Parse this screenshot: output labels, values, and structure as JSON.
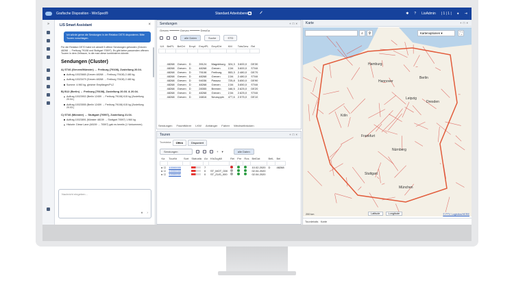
{
  "window": {
    "app_title": "Grafische Disposition - WinSped®",
    "workspace": "Standard Arbeitsbereich",
    "user": "LisAdmin",
    "counter": "| 1 | 1 |"
  },
  "assistant": {
    "title": "LIS Smart Assistant",
    "user_msg": "Ich würde gerne die Sendungen in der Relation DE70 disponieren. Bitte Touren vorschlagen.",
    "intro": "Für die Relation DE70 habe ich aktuell 5 offene Sendungen gefunden (Greven 48268 → Freiburg 79108 und Stuttgart 70597). Es gibt keine passenden offenen Touren in dem Zeitraum, in die man diese kombinieren könnte.",
    "heading": "Sendungen (Cluster)",
    "clusters": [
      {
        "title": "A) ST46 (Greven/Münster) → Freiburg (79108), Zustellung 20.04.",
        "items": [
          "Auftrag 10023665 (Greven 48268 → Freiburg 79108) 2.480 kg",
          "Auftrag 10023479 (Greven 48268 → Freiburg 79108) 2.480 kg",
          "Summe: 4.960 kg, gleicher Empfänger/PLZ"
        ]
      },
      {
        "title": "B) B12 (Berlin) → Freiburg (79108), Zustellung 20.03. & 20.04.",
        "items": [
          "Auftrag 10023902 (Berlin 12459 → Freiburg 79108) 615 kg (Zustellung 20.04.)",
          "Auftrag 10023555 (Berlin 12459 → Freiburg 79108) 615 kg (Zustellung 20.03.)"
        ]
      },
      {
        "title": "C) ST46 (Münster) → Stuttgart (70597), Zustellung 21.04.",
        "items": [
          "Auftrag 10023891 (Münster 48159 → Stuttgart 70597) 1.960 kg",
          "Historie: Diese Lane (48159 → 70597) gab es bereits (1 Vorkommen)."
        ]
      }
    ],
    "message_placeholder": "Nachricht eingeben..."
  },
  "sendungen": {
    "title": "Sendungen",
    "filter_text": "Greven ━━━━━━ Greven ━━━━━━ Dreußa",
    "all_data_btn": "alle Daten",
    "search_label": "Suche",
    "std_label": "STD",
    "columns": [
      "ILK",
      "BelPL",
      "BelOrt",
      "Empf.",
      "EmpfPL",
      "EmpfOrt",
      "KM",
      "TotsGew",
      "Rel"
    ],
    "rows": [
      [
        "",
        "48268",
        "Greven",
        "D",
        "39124",
        "Magdeburg",
        "324,3",
        "3.600,0",
        "DE30"
      ],
      [
        "",
        "48268",
        "Greven",
        "D",
        "48268",
        "Greven",
        "2,54",
        "3.600,0",
        "ST48"
      ],
      [
        "",
        "48268",
        "Greven",
        "D",
        "79108",
        "Freiburg",
        "553,3",
        "2.480,0",
        "DE70"
      ],
      [
        "",
        "48268",
        "Greven",
        "D",
        "48268",
        "Greven",
        "2,54",
        "2.480,0",
        "ST48"
      ],
      [
        "",
        "48268",
        "Greven",
        "D",
        "94036",
        "Passau",
        "725,8",
        "3.650,0",
        "DE90"
      ],
      [
        "",
        "48268",
        "Greven",
        "D",
        "48268",
        "Greven",
        "2,54",
        "3.650,0",
        "ST48"
      ],
      [
        "",
        "48268",
        "Greven",
        "D",
        "28355",
        "Bremen",
        "166,5",
        "2.625,0",
        "DE20"
      ],
      [
        "",
        "48268",
        "Greven",
        "D",
        "48268",
        "Greven",
        "2,54",
        "2.625,0",
        "ST48"
      ],
      [
        "",
        "48268",
        "Greven",
        "D",
        "16816",
        "Neuruppin",
        "477,6",
        "2.575,0",
        "DE10"
      ]
    ],
    "bottom_tabs": [
      "Sendungen",
      "Frachtführer",
      "LKW",
      "Anhänger",
      "Fahrer",
      "Wechselbrücken"
    ]
  },
  "touren": {
    "title": "Touren",
    "subtitle": "Tourstatus",
    "tabs": [
      "Offen",
      "Disponiert"
    ],
    "dropdown": "Sendungen",
    "all_data_btn": "alle Daten",
    "columns": [
      "Ka",
      "TourNr",
      "Sort",
      "Statusfa",
      "An",
      "KfzZugMi",
      "Rei",
      "Pre",
      "Ros",
      "BeiDat",
      "BelL",
      "Bel"
    ],
    "rows": [
      {
        "tour": "10000000",
        "an": "7",
        "kfz": "",
        "date": "10.02.2020",
        "bell": "D",
        "bel": "48268"
      },
      {
        "tour": "10000000",
        "an": "0",
        "kfz": "ST_MOT_000",
        "date": "02.04.2020",
        "bell": "",
        "bel": ""
      },
      {
        "tour": "10000001",
        "an": "0",
        "kfz": "ST_ZUG_000",
        "date": "02.04.2020",
        "bell": "",
        "bel": ""
      }
    ]
  },
  "karte": {
    "title": "Karte",
    "options_label": "Kartenoptionen",
    "scale": "200 km",
    "lat_label": "Latitude",
    "lng_label": "Longitude",
    "credit": "© PTV Logistics/HERE",
    "footer": [
      "Tourdetails",
      "Karte"
    ],
    "cities": [
      "Hamburg",
      "Berlin",
      "Hannover",
      "Köln",
      "Frankfurt",
      "Stuttgart",
      "München",
      "Dresden",
      "Leipzig",
      "Nürnberg"
    ],
    "colors": {
      "land": "#f4f0e6",
      "border": "#e25b3a",
      "road": "#d94b45",
      "water": "#b8d3ea"
    }
  }
}
